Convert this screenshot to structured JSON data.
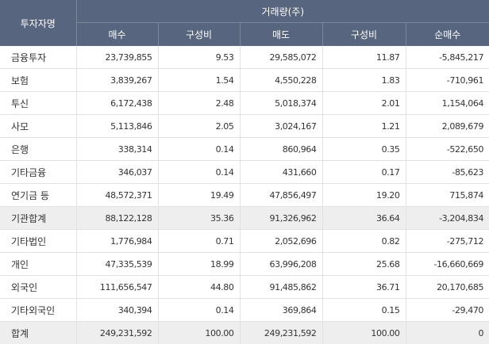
{
  "headers": {
    "investor": "투자자명",
    "volume_group": "거래량(주)",
    "columns": [
      "매수",
      "구성비",
      "매도",
      "구성비",
      "순매수"
    ]
  },
  "rows": [
    {
      "name": "금융투자",
      "buy": "23,739,855",
      "buy_ratio": "9.53",
      "sell": "29,585,072",
      "sell_ratio": "11.87",
      "net": "-5,845,217"
    },
    {
      "name": "보험",
      "buy": "3,839,267",
      "buy_ratio": "1.54",
      "sell": "4,550,228",
      "sell_ratio": "1.83",
      "net": "-710,961"
    },
    {
      "name": "투신",
      "buy": "6,172,438",
      "buy_ratio": "2.48",
      "sell": "5,018,374",
      "sell_ratio": "2.01",
      "net": "1,154,064"
    },
    {
      "name": "사모",
      "buy": "5,113,846",
      "buy_ratio": "2.05",
      "sell": "3,024,167",
      "sell_ratio": "1.21",
      "net": "2,089,679"
    },
    {
      "name": "은행",
      "buy": "338,314",
      "buy_ratio": "0.14",
      "sell": "860,964",
      "sell_ratio": "0.35",
      "net": "-522,650"
    },
    {
      "name": "기타금융",
      "buy": "346,037",
      "buy_ratio": "0.14",
      "sell": "431,660",
      "sell_ratio": "0.17",
      "net": "-85,623"
    },
    {
      "name": "연기금 등",
      "buy": "48,572,371",
      "buy_ratio": "19.49",
      "sell": "47,856,497",
      "sell_ratio": "19.20",
      "net": "715,874"
    },
    {
      "name": "기관합계",
      "buy": "88,122,128",
      "buy_ratio": "35.36",
      "sell": "91,326,962",
      "sell_ratio": "36.64",
      "net": "-3,204,834"
    },
    {
      "name": "기타법인",
      "buy": "1,776,984",
      "buy_ratio": "0.71",
      "sell": "2,052,696",
      "sell_ratio": "0.82",
      "net": "-275,712"
    },
    {
      "name": "개인",
      "buy": "47,335,539",
      "buy_ratio": "18.99",
      "sell": "63,996,208",
      "sell_ratio": "25.68",
      "net": "-16,660,669"
    },
    {
      "name": "외국인",
      "buy": "111,656,547",
      "buy_ratio": "44.80",
      "sell": "91,485,862",
      "sell_ratio": "36.71",
      "net": "20,170,685"
    },
    {
      "name": "기타외국인",
      "buy": "340,394",
      "buy_ratio": "0.14",
      "sell": "369,864",
      "sell_ratio": "0.15",
      "net": "-29,470"
    },
    {
      "name": "합계",
      "buy": "249,231,592",
      "buy_ratio": "100.00",
      "sell": "249,231,592",
      "sell_ratio": "100.00",
      "net": "0"
    }
  ],
  "colors": {
    "header_bg": "#58657e",
    "header_text": "#ffffff",
    "subtotal_bg": "#eeeeee",
    "border": "#e2e2e2"
  }
}
